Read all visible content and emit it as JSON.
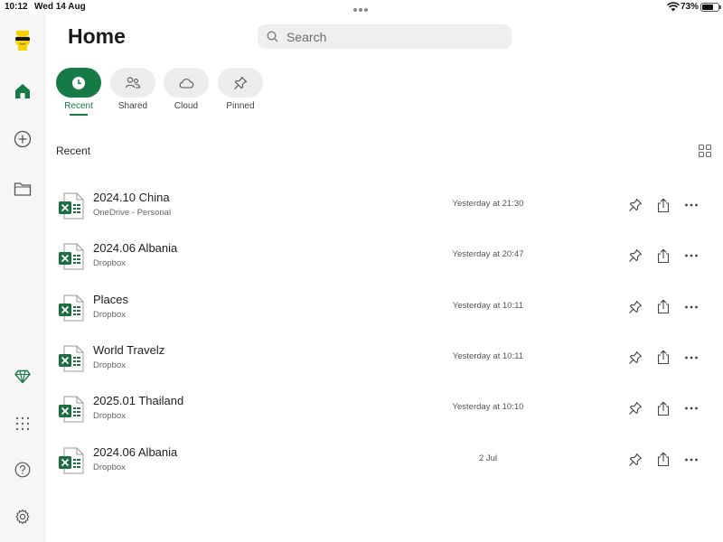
{
  "status_bar": {
    "time": "10:12",
    "date": "Wed 14 Aug",
    "battery": "73%",
    "battery_level": 0.73
  },
  "sidebar": {
    "items": [
      {
        "name": "avatar",
        "icon": "avatar"
      },
      {
        "name": "home",
        "icon": "home-icon",
        "active": true
      },
      {
        "name": "new",
        "icon": "plus-circle-icon"
      },
      {
        "name": "open",
        "icon": "folder-icon"
      },
      {
        "name": "premium",
        "icon": "diamond-icon"
      },
      {
        "name": "apps",
        "icon": "grid-dots-icon"
      },
      {
        "name": "help",
        "icon": "help-icon"
      },
      {
        "name": "settings",
        "icon": "gear-icon"
      }
    ]
  },
  "header": {
    "title": "Home",
    "search_placeholder": "Search"
  },
  "tabs": [
    {
      "label": "Recent",
      "icon": "clock-icon",
      "active": true
    },
    {
      "label": "Shared",
      "icon": "people-icon",
      "active": false
    },
    {
      "label": "Cloud",
      "icon": "cloud-icon",
      "active": false
    },
    {
      "label": "Pinned",
      "icon": "pin-icon",
      "active": false
    }
  ],
  "section": {
    "label": "Recent"
  },
  "files": [
    {
      "name": "2024.10 China",
      "location": "OneDrive - Personal",
      "modified": "Yesterday at 21:30"
    },
    {
      "name": "2024.06 Albania",
      "location": "Dropbox",
      "modified": "Yesterday at 20:47"
    },
    {
      "name": "Places",
      "location": "Dropbox",
      "modified": "Yesterday at 10:11"
    },
    {
      "name": "World Travelz",
      "location": "Dropbox",
      "modified": "Yesterday at 10:11"
    },
    {
      "name": "2025.01 Thailand",
      "location": "Dropbox",
      "modified": "Yesterday at 10:10"
    },
    {
      "name": "2024.06 Albania",
      "location": "Dropbox",
      "modified": "2 Jul"
    }
  ],
  "colors": {
    "accent": "#157a46",
    "excel_green": "#1d6f42"
  }
}
